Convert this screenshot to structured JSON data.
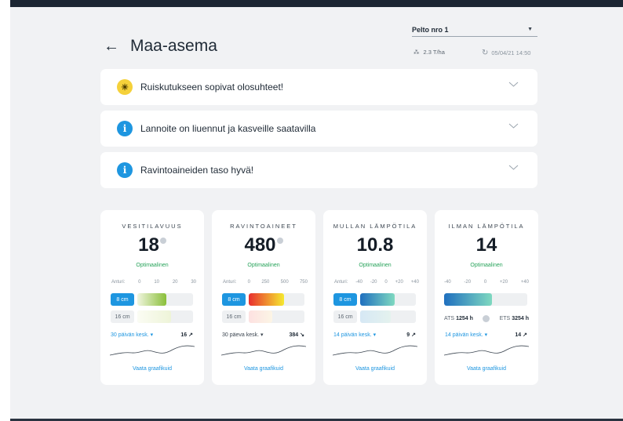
{
  "header": {
    "title": "Maa-asema",
    "field_select": "Pelto nro 1",
    "yield": "2.3 T/ha",
    "updated": "05/04/21 14:50"
  },
  "alerts": [
    {
      "text": "Ruiskutukseen sopivat olosuhteet!",
      "icon": "lightbulb-icon"
    },
    {
      "text": "Lannoite on liuennut ja kasveille saatavilla",
      "icon": "info-icon"
    },
    {
      "text": "Ravintoaineiden taso hyvä!",
      "icon": "info-icon"
    }
  ],
  "cards": [
    {
      "title": "VESITILAVUUS",
      "value": "18",
      "status": "Optimaalinen",
      "scale": [
        "Anturi:",
        "0",
        "10",
        "20",
        "30"
      ],
      "depths": [
        {
          "label": "8 cm",
          "level": 0.52,
          "gradient": [
            "#f0f5df",
            "#8abf3a"
          ]
        },
        {
          "label": "16 cm",
          "level": 0.6,
          "gradient": [
            "#fbfcf4",
            "#eef4d8"
          ]
        }
      ],
      "avg_label": "30 päivän kesk.",
      "avg_value": "16 ↗",
      "link": "Vaata graafikuid"
    },
    {
      "title": "RAVINTOAINEET",
      "value": "480",
      "status": "Optimaalinen",
      "scale": [
        "Anturi:",
        "0",
        "250",
        "500",
        "750"
      ],
      "depths": [
        {
          "label": "8 cm",
          "level": 0.64,
          "gradient": [
            "#e82f2f",
            "#f5e930"
          ]
        },
        {
          "label": "16 cm",
          "level": 0.42,
          "gradient": [
            "#fde1e1",
            "#fcf5e5"
          ]
        }
      ],
      "avg_label": "30 päeva kesk.",
      "avg_value": "384 ↘",
      "link": "Vaata graafikuid"
    },
    {
      "title": "MULLAN LÄMPÖTILA",
      "value": "10.8",
      "status": "Optimaalinen",
      "scale": [
        "Anturi:",
        "-40",
        "-20",
        "0",
        "+20",
        "+40"
      ],
      "depths": [
        {
          "label": "8 cm",
          "level": 0.62,
          "gradient": [
            "#1f6fbf",
            "#7fd9c0"
          ]
        },
        {
          "label": "16 cm",
          "level": 0.55,
          "gradient": [
            "#d6e8f5",
            "#e4f2ee"
          ]
        }
      ],
      "avg_label": "14 päivän kesk.",
      "avg_value": "9 ↗",
      "link": "Vaata graafikuid"
    },
    {
      "title": "ILMAN LÄMPÖTILA",
      "value": "14",
      "status": "Optimaalinen",
      "scale": [
        "-40",
        "-20",
        "0",
        "+20",
        "+40"
      ],
      "ats_label": "ATS",
      "ats_value": "1254 h",
      "ets_label": "ETS",
      "ets_value": "3254 h",
      "avg_label": "14 päivän kesk.",
      "avg_value": "14 ↗",
      "link": "Vaata graafikuid"
    }
  ],
  "colors": {
    "accent": "#1e96e0",
    "ok": "#27a35a"
  }
}
